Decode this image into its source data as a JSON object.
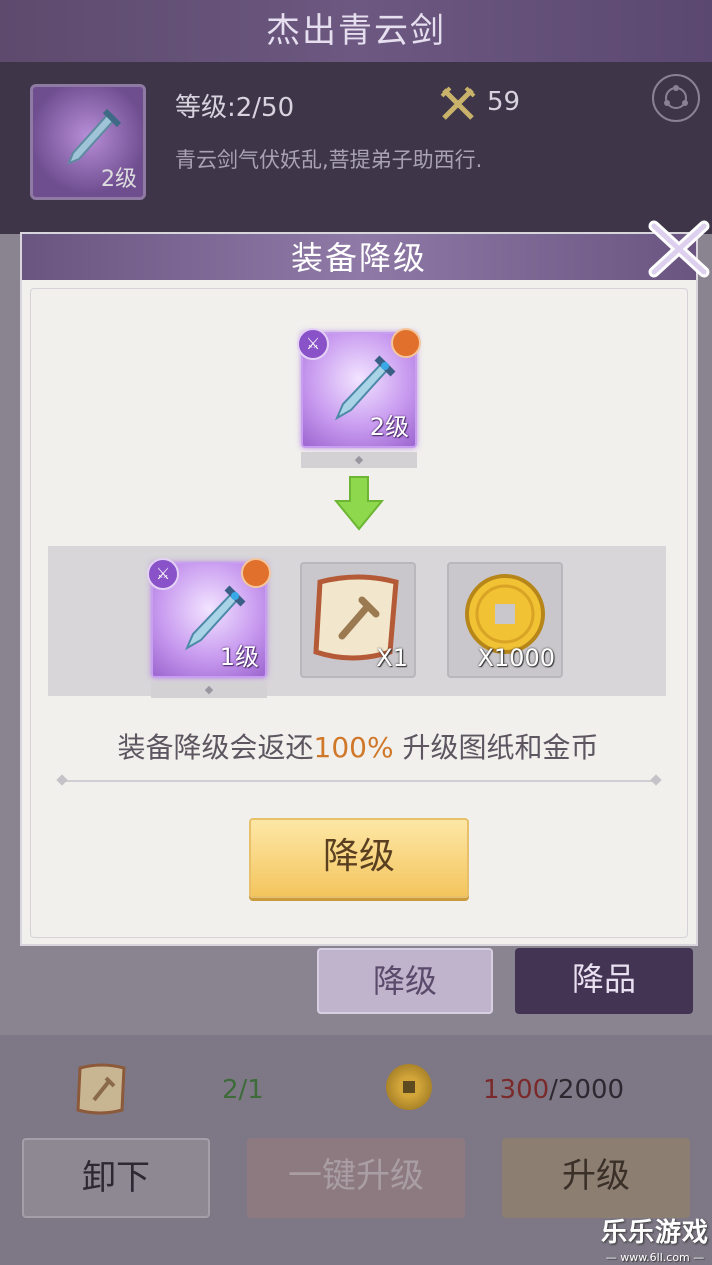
{
  "background": {
    "title": "杰出青云剑",
    "item": {
      "level_badge": "2级"
    },
    "level_text": "等级:2/50",
    "power_value": "59",
    "description": "青云剑气伏妖乱,菩提弟子助西行.",
    "tabs": {
      "downgrade_label": "降级",
      "quality_label": "降品"
    },
    "costs": {
      "blueprint_count": "2/1",
      "gold_current": "1300",
      "gold_required": "/2000"
    },
    "buttons": {
      "unload_label": "卸下",
      "one_key_upgrade_label": "一键升级",
      "upgrade_label": "升级"
    }
  },
  "modal": {
    "title": "装备降级",
    "current_item": {
      "level_badge": "2级"
    },
    "result_item": {
      "level_badge": "1级"
    },
    "blueprint_qty": "X1",
    "gold_qty": "X1000",
    "note_prefix": "装备降级会返还",
    "note_percent": "100%",
    "note_suffix": " 升级图纸和金币",
    "confirm_label": "降级"
  },
  "watermark": {
    "line1": "乐乐游戏",
    "line2": "— www.6ll.com —"
  },
  "colors": {
    "accent_purple": "#6a5480",
    "highlight_orange": "#d0782a",
    "confirm_gold": "#f4c55e"
  }
}
